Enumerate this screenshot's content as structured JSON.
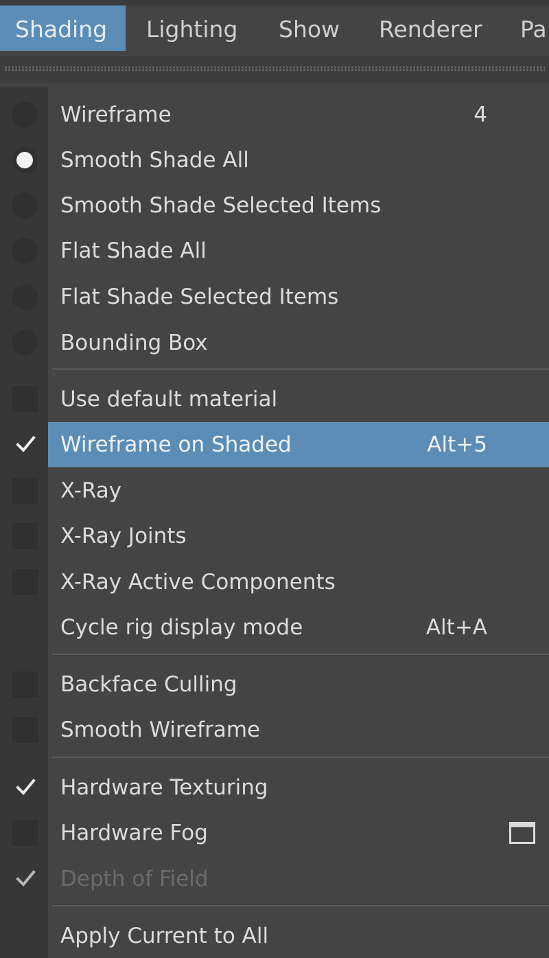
{
  "menubar": {
    "items": [
      "Shading",
      "Lighting",
      "Show",
      "Renderer",
      "Pa"
    ],
    "active": "Shading"
  },
  "menu": {
    "wireframe": {
      "label": "Wireframe",
      "shortcut": "4",
      "selected": false
    },
    "smooth_shade_all": {
      "label": "Smooth Shade All",
      "selected": true
    },
    "smooth_shade_selected": {
      "label": "Smooth Shade Selected Items",
      "selected": false
    },
    "flat_shade_all": {
      "label": "Flat Shade All",
      "selected": false
    },
    "flat_shade_selected": {
      "label": "Flat Shade Selected Items",
      "selected": false
    },
    "bounding_box": {
      "label": "Bounding Box",
      "selected": false
    },
    "use_default_material": {
      "label": "Use default material",
      "checked": false
    },
    "wireframe_on_shaded": {
      "label": "Wireframe on Shaded",
      "shortcut": "Alt+5",
      "checked": true,
      "highlighted": true
    },
    "xray": {
      "label": "X-Ray",
      "checked": false
    },
    "xray_joints": {
      "label": "X-Ray Joints",
      "checked": false
    },
    "xray_active_components": {
      "label": "X-Ray Active Components",
      "checked": false
    },
    "cycle_rig_display_mode": {
      "label": "Cycle rig display mode",
      "shortcut": "Alt+A"
    },
    "backface_culling": {
      "label": "Backface Culling",
      "checked": false
    },
    "smooth_wireframe": {
      "label": "Smooth Wireframe",
      "checked": false
    },
    "hardware_texturing": {
      "label": "Hardware Texturing",
      "checked": true
    },
    "hardware_fog": {
      "label": "Hardware Fog",
      "checked": false,
      "option_box_icon": "option-box-icon"
    },
    "depth_of_field": {
      "label": "Depth of Field",
      "checked": true,
      "enabled": false
    },
    "apply_current_to_all": {
      "label": "Apply Current to All"
    }
  },
  "colors": {
    "background": "#444444",
    "gutter": "#373737",
    "highlight": "#5b8db6",
    "text": "#dcdcdc",
    "disabled_text": "#6b6b6b"
  }
}
